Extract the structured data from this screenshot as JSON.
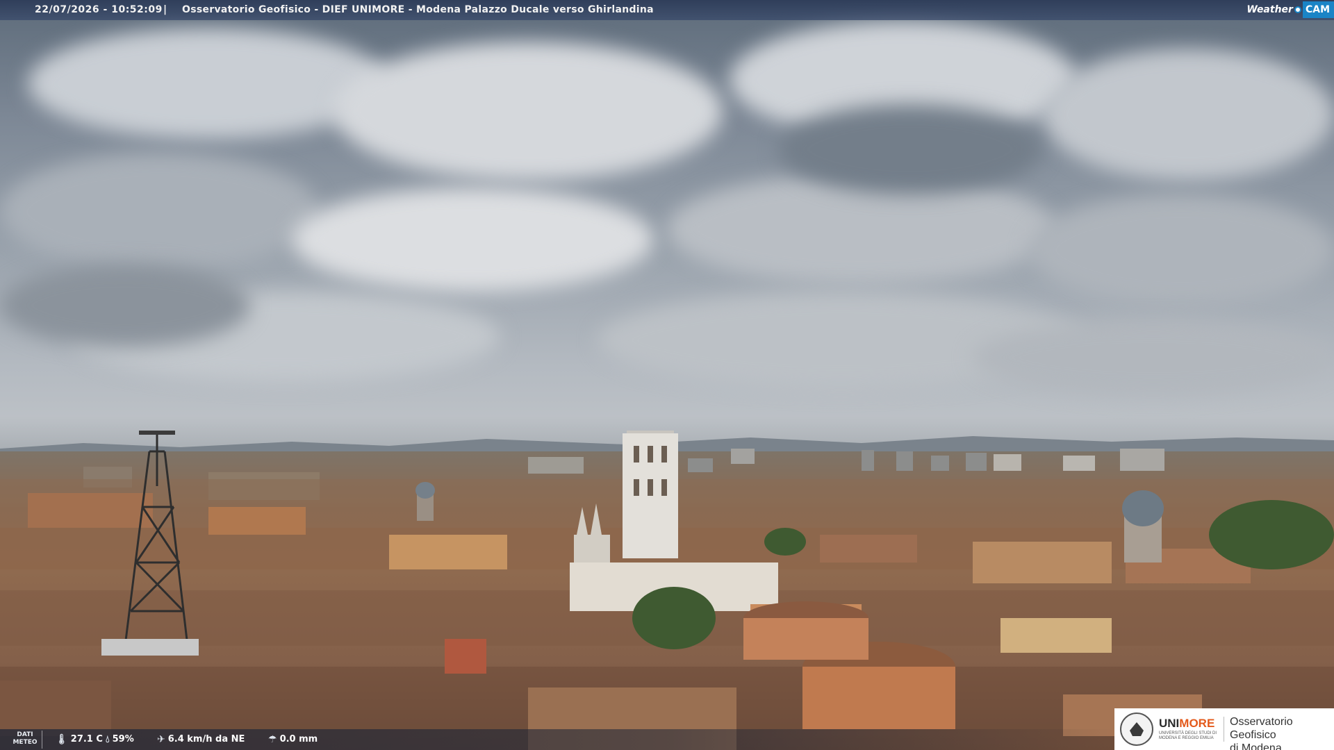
{
  "banner": {
    "timestamp": "22/07/2026 - 10:52:09",
    "separator": "|",
    "title": "Osservatorio Geofisico - DIEF UNIMORE - Modena Palazzo Ducale verso Ghirlandina"
  },
  "brand_logo": {
    "part1": "Weather",
    "part2": "CAM",
    "accent_color": "#1a84c6"
  },
  "meteo": {
    "label_line1": "DATI",
    "label_line2": "METEO",
    "temperature": "27.1 C",
    "temperature_icon": "thermometer-icon",
    "humidity": "59%",
    "humidity_icon": "humidity-icon",
    "wind": "6.4 km/h da NE",
    "wind_icon": "wind-icon",
    "rain": "0.0 mm",
    "rain_icon": "rain-icon"
  },
  "institution": {
    "name_part1": "UNI",
    "name_part2": "MORE",
    "name_color_accent": "#e35a1c",
    "subtitle": "UNIVERSITÀ DEGLI STUDI DI MODENA E REGGIO EMILIA",
    "observatory_line1": "Osservatorio Geofisico",
    "observatory_line2": "di Modena"
  }
}
